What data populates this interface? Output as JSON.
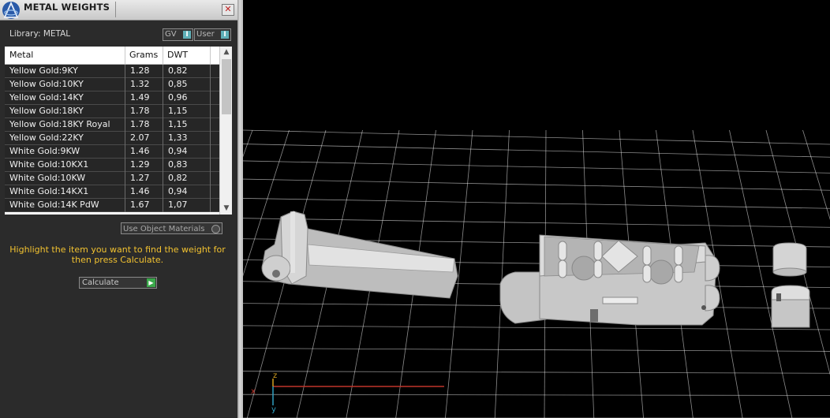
{
  "panel": {
    "title": "METAL WEIGHTS",
    "close_glyph": "✕",
    "library_label": "Library: METAL",
    "toggles": [
      {
        "label": "GV",
        "checked": true
      },
      {
        "label": "User",
        "checked": true
      }
    ],
    "table": {
      "columns": [
        "Metal",
        "Grams",
        "DWT"
      ],
      "rows": [
        {
          "metal": "Yellow Gold:9KY",
          "grams": "1.28",
          "dwt": "0,82"
        },
        {
          "metal": "Yellow Gold:10KY",
          "grams": "1.32",
          "dwt": "0,85"
        },
        {
          "metal": "Yellow Gold:14KY",
          "grams": "1.49",
          "dwt": "0,96"
        },
        {
          "metal": "Yellow Gold:18KY",
          "grams": "1.78",
          "dwt": "1,15"
        },
        {
          "metal": "Yellow Gold:18KY Royal",
          "grams": "1.78",
          "dwt": "1,15"
        },
        {
          "metal": "Yellow Gold:22KY",
          "grams": "2.07",
          "dwt": "1,33"
        },
        {
          "metal": "White Gold:9KW",
          "grams": "1.46",
          "dwt": "0,94"
        },
        {
          "metal": "White Gold:10KX1",
          "grams": "1.29",
          "dwt": "0,83"
        },
        {
          "metal": "White Gold:10KW",
          "grams": "1.27",
          "dwt": "0,82"
        },
        {
          "metal": "White Gold:14KX1",
          "grams": "1.46",
          "dwt": "0,94"
        },
        {
          "metal": "White Gold:14K PdW",
          "grams": "1.67",
          "dwt": "1,07"
        }
      ]
    },
    "use_object_materials_label": "Use Object Materials",
    "instructions": "Highlight the item you want to find the weight for then press Calculate.",
    "calculate_label": "Calculate",
    "colors": {
      "instructions": "#f2c230",
      "accent": "#5fb0b8",
      "calculate_arrow": "#3aa84a"
    }
  },
  "viewport": {
    "axes": {
      "x_label": "x",
      "y_label": "y",
      "z_label": "z"
    },
    "objects": [
      "hinge-lever-part",
      "clasp-box-part",
      "small-tube-part"
    ],
    "colors": {
      "grid": "#ffffff",
      "x_axis": "#c0342a",
      "y_axis": "#2f9fc0",
      "z_axis": "#d4a020",
      "part": "#c8c8c8"
    }
  }
}
